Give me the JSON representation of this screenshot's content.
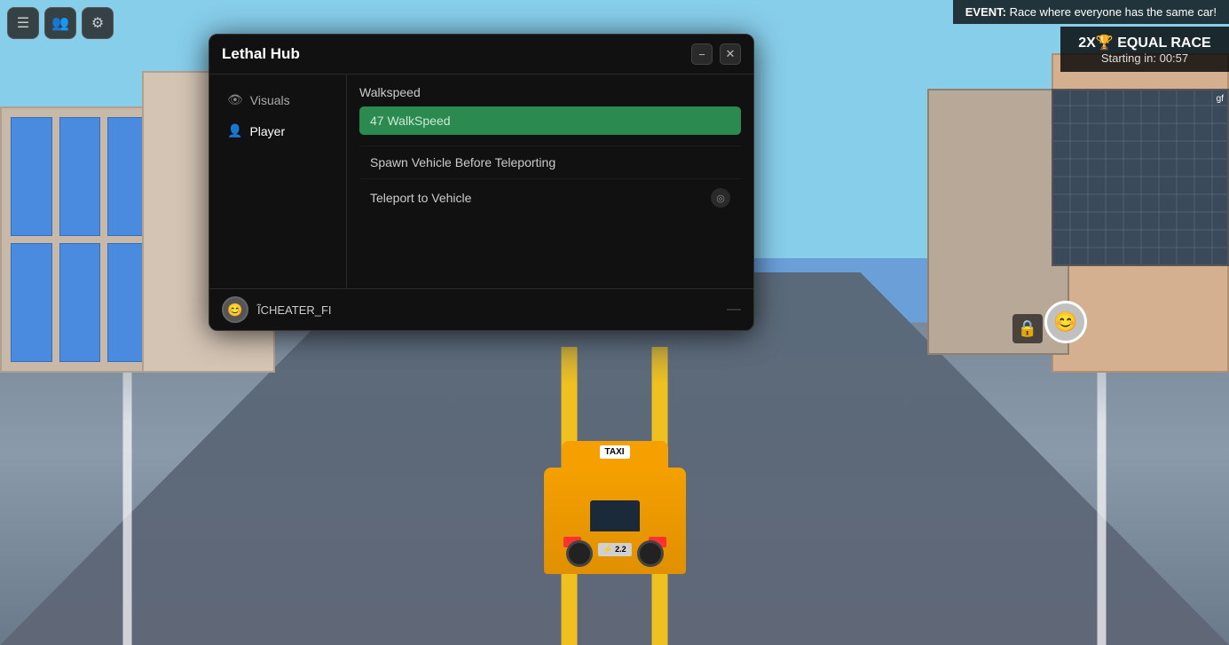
{
  "game": {
    "event_label": "EVENT:",
    "event_text": " Race where everyone has the same car!",
    "race_title": "2X🏆 EQUAL RACE",
    "race_subtitle": "Starting in: 00:57",
    "minimap_username": "gf",
    "taxi_sign": "TAXI",
    "taxi_plate": "⚡ 2.2"
  },
  "topbar": {
    "btn1_icon": "☰",
    "btn2_icon": "👥",
    "btn3_icon": "⚙"
  },
  "modal": {
    "title": "Lethal Hub",
    "minimize_label": "−",
    "close_label": "✕",
    "sidebar": {
      "items": [
        {
          "id": "visuals",
          "label": "Visuals",
          "icon": "👁"
        },
        {
          "id": "player",
          "label": "Player",
          "icon": "👤"
        }
      ]
    },
    "content": {
      "walkspeed_label": "Walkspeed",
      "walkspeed_value": "47 WalkSpeed",
      "walkspeed_placeholder": "WalkSpeed",
      "spawn_vehicle_label": "Spawn Vehicle Before Teleporting",
      "teleport_vehicle_label": "Teleport to Vehicle",
      "teleport_icon": "🎯"
    },
    "footer": {
      "username": "ĨCHEATER_FI",
      "dash": "—",
      "avatar_icon": "😊"
    }
  }
}
